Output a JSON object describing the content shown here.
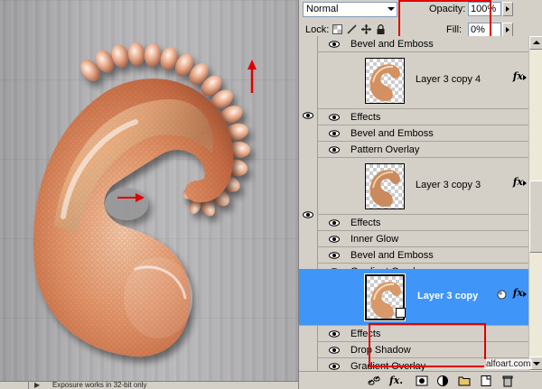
{
  "canvas": {
    "status_text": "Exposure works in 32-bit only",
    "status_arrow": "▶"
  },
  "panel": {
    "blend_mode": "Normal",
    "opacity_label": "Opacity:",
    "opacity_value": "100%",
    "lock_label": "Lock:",
    "fill_label": "Fill:",
    "fill_value": "0%",
    "fx_symbol": "fx"
  },
  "layers_list": {
    "top_partial_effect": "Bevel and Emboss",
    "layers": [
      {
        "name": "Layer 3 copy 4",
        "selected": false,
        "effects_label": "Effects",
        "effects": [
          "Bevel and Emboss",
          "Pattern Overlay"
        ]
      },
      {
        "name": "Layer 3 copy 3",
        "selected": false,
        "effects_label": "Effects",
        "effects": [
          "Inner Glow",
          "Bevel and Emboss",
          "Gradient Overlay"
        ]
      },
      {
        "name": "Layer 3 copy",
        "selected": true,
        "effects_label": "Effects",
        "effects": [
          "Drop Shadow",
          "Gradient Overlay"
        ]
      }
    ]
  },
  "bottom_toolbar": {
    "icons": [
      "link-layers-icon",
      "fx-icon",
      "layer-mask-icon",
      "adjustment-layer-icon",
      "group-folder-icon",
      "new-layer-icon",
      "trash-icon"
    ],
    "fx_text": "fx."
  },
  "watermark": "alfoart.com",
  "colors": {
    "selection_blue": "#3f95f8",
    "highlight_red": "#e00000",
    "panel_gray": "#d4d0c8"
  }
}
